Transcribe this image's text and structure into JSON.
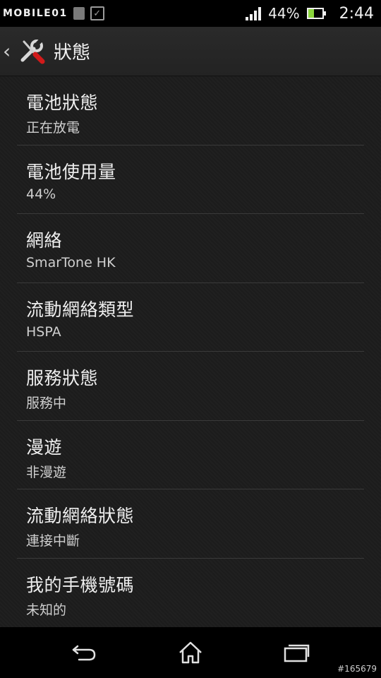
{
  "status_bar": {
    "watermark": "MOBILE01",
    "battery_percent_label": "44%",
    "battery_level": 0.44,
    "time": "2:44",
    "signal_level": 4
  },
  "action_bar": {
    "title": "狀態",
    "icon": "tools-icon"
  },
  "items": [
    {
      "title": "電池狀態",
      "value": "正在放電"
    },
    {
      "title": "電池使用量",
      "value": "44%"
    },
    {
      "title": "網絡",
      "value": "SmarTone HK"
    },
    {
      "title": "流動網絡類型",
      "value": "HSPA"
    },
    {
      "title": "服務狀態",
      "value": "服務中"
    },
    {
      "title": "漫遊",
      "value": "非漫遊"
    },
    {
      "title": "流動網絡狀態",
      "value": "連接中斷"
    },
    {
      "title": "我的手機號碼",
      "value": "未知的"
    }
  ],
  "nav_bar": {
    "buttons": [
      "back-icon",
      "home-icon",
      "recent-apps-icon"
    ]
  },
  "image_tag": "#165679",
  "colors": {
    "background": "#1c1c1c",
    "battery_fill": "#8bd63c",
    "tool_handle": "#d11a1a"
  }
}
